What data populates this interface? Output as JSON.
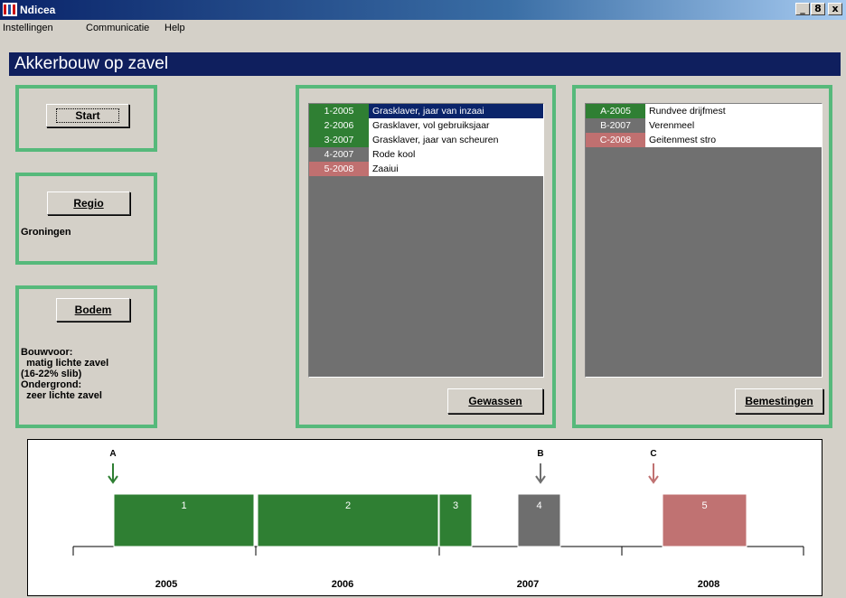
{
  "window": {
    "title": "Ndicea",
    "controls": [
      "_",
      "8",
      "x"
    ]
  },
  "menu": [
    "Instellingen",
    "Communicatie",
    "Help"
  ],
  "header": {
    "title": "Akkerbouw op zavel"
  },
  "start": {
    "label": "Start"
  },
  "region": {
    "button": "Regio",
    "value": "Groningen"
  },
  "soil": {
    "button": "Bodem",
    "info": "Bouwvoor:\n  matig lichte zavel\n(16-22% slib)\nOndergrond:\n  zeer lichte zavel"
  },
  "crops": {
    "items": [
      {
        "code": "1-2005",
        "name": "Grasklaver, jaar van inzaai",
        "color": "#2f7f33",
        "selected": true
      },
      {
        "code": "2-2006",
        "name": "Grasklaver, vol gebruiksjaar",
        "color": "#2f7f33",
        "selected": false
      },
      {
        "code": "3-2007",
        "name": "Grasklaver, jaar van scheuren",
        "color": "#2f7f33",
        "selected": false
      },
      {
        "code": "4-2007",
        "name": "Rode kool",
        "color": "#707070",
        "selected": false
      },
      {
        "code": "5-2008",
        "name": "Zaaiui",
        "color": "#c07070",
        "selected": false
      }
    ],
    "button": "Gewassen"
  },
  "fertilizers": {
    "items": [
      {
        "code": "A-2005",
        "name": "Rundvee drijfmest",
        "color": "#2f7f33"
      },
      {
        "code": "B-2007",
        "name": "Verenmeel",
        "color": "#707070"
      },
      {
        "code": "C-2008",
        "name": "Geitenmest stro",
        "color": "#c07070"
      }
    ],
    "button": "Bemestingen"
  },
  "timeline": {
    "years": [
      "2005",
      "2006",
      "2007",
      "2008"
    ],
    "bars": [
      {
        "label": "1",
        "color": "#2f7f33"
      },
      {
        "label": "2",
        "color": "#2f7f33"
      },
      {
        "label": "3",
        "color": "#2f7f33"
      },
      {
        "label": "4",
        "color": "#6e6e6e"
      },
      {
        "label": "5",
        "color": "#c07272"
      }
    ],
    "markers": [
      {
        "label": "A",
        "color": "#2f7f33"
      },
      {
        "label": "B",
        "color": "#6e6e6e"
      },
      {
        "label": "C",
        "color": "#c07272"
      }
    ]
  }
}
